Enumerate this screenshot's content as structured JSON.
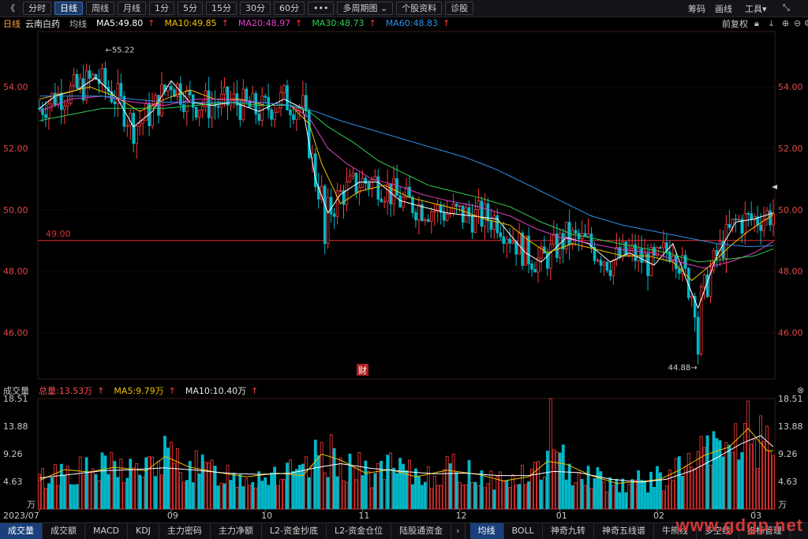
{
  "toolbar": {
    "back_icon": "《",
    "tabs": [
      "分时",
      "日线",
      "周线",
      "月线",
      "1分",
      "5分",
      "15分",
      "30分",
      "60分",
      "•••",
      "多周期图",
      "个股资料",
      "诊股"
    ],
    "active_tab": "日线",
    "right": [
      "筹码",
      "画线",
      "工具"
    ]
  },
  "stock": {
    "period": "日线",
    "name": "云南白药",
    "ma_label": "均线",
    "ma5": "MA5:49.80",
    "ma10": "MA10:49.85",
    "ma20": "MA20:48.97",
    "ma30": "MA30:48.73",
    "ma60": "MA60:48.83",
    "adjust": "前复权"
  },
  "volume": {
    "label": "成交量",
    "total": "总量:13.53万",
    "ma5": "MA5:9.79万",
    "ma10": "MA10:10.40万"
  },
  "bottom_tabs": [
    "成交量",
    "成交额",
    "MACD",
    "KDJ",
    "主力密码",
    "主力净额",
    "L2-资金抄底",
    "L2-资金仓位",
    "陆股通资金"
  ],
  "bottom_tabs_right": [
    "均线",
    "BOLL",
    "神奇九转",
    "神奇五线谱",
    "牛熊线",
    "多空线",
    "指标管理"
  ],
  "watermark": "www.gdgp.net",
  "colors": {
    "up": "#ff3a3a",
    "down": "#00b8c8",
    "ma5": "#ffffff",
    "ma10": "#f2c200",
    "ma20": "#e040c8",
    "ma30": "#2ecc55",
    "ma60": "#2f8fe8",
    "line49": "#e03030"
  },
  "chart_data": [
    {
      "type": "candlestick",
      "title": "云南白药 日线",
      "y_ticks": [
        "54.00",
        "52.00",
        "50.00",
        "48.00",
        "46.00"
      ],
      "x_ticks": [
        "2023/07",
        "09",
        "10",
        "11",
        "12",
        "01",
        "02",
        "03"
      ],
      "ylim": [
        44.5,
        55.8
      ],
      "annotations": {
        "high": "←55.22",
        "low": "44.88→",
        "hline": "49.00",
        "hline_value": 49.0,
        "marker": "财"
      },
      "ma": {
        "ma5": [
          [
            0,
            53.3
          ],
          [
            5,
            53.7
          ],
          [
            12,
            53.9
          ],
          [
            18,
            54.3
          ],
          [
            25,
            53.6
          ],
          [
            30,
            52.7
          ],
          [
            36,
            53.2
          ],
          [
            42,
            54.2
          ],
          [
            48,
            53.5
          ],
          [
            55,
            53.4
          ],
          [
            62,
            53.5
          ],
          [
            70,
            53.2
          ],
          [
            78,
            53.6
          ],
          [
            84,
            53.3
          ],
          [
            88,
            51.0
          ],
          [
            92,
            49.9
          ],
          [
            96,
            50.5
          ],
          [
            102,
            50.9
          ],
          [
            108,
            50.9
          ],
          [
            115,
            50.3
          ],
          [
            122,
            50.1
          ],
          [
            130,
            49.9
          ],
          [
            138,
            49.8
          ],
          [
            146,
            49.7
          ],
          [
            150,
            49.2
          ],
          [
            155,
            48.6
          ],
          [
            160,
            48.3
          ],
          [
            168,
            49.1
          ],
          [
            175,
            48.9
          ],
          [
            182,
            48.3
          ],
          [
            188,
            48.6
          ],
          [
            196,
            48.2
          ],
          [
            202,
            48.9
          ],
          [
            206,
            47.8
          ],
          [
            210,
            46.8
          ],
          [
            216,
            48.5
          ],
          [
            222,
            49.6
          ],
          [
            228,
            49.7
          ],
          [
            234,
            49.9
          ]
        ],
        "ma10": [
          [
            0,
            53.6
          ],
          [
            8,
            53.8
          ],
          [
            16,
            54.0
          ],
          [
            24,
            53.7
          ],
          [
            32,
            53.2
          ],
          [
            40,
            53.6
          ],
          [
            48,
            53.9
          ],
          [
            56,
            53.6
          ],
          [
            64,
            53.6
          ],
          [
            72,
            53.4
          ],
          [
            80,
            53.4
          ],
          [
            86,
            52.8
          ],
          [
            90,
            51.5
          ],
          [
            96,
            50.2
          ],
          [
            102,
            50.6
          ],
          [
            110,
            50.8
          ],
          [
            118,
            50.4
          ],
          [
            126,
            50.2
          ],
          [
            134,
            50.0
          ],
          [
            142,
            49.7
          ],
          [
            150,
            49.5
          ],
          [
            156,
            49.0
          ],
          [
            162,
            48.6
          ],
          [
            170,
            48.9
          ],
          [
            178,
            48.7
          ],
          [
            186,
            48.5
          ],
          [
            194,
            48.5
          ],
          [
            202,
            48.3
          ],
          [
            208,
            47.7
          ],
          [
            214,
            48.2
          ],
          [
            220,
            48.8
          ],
          [
            226,
            49.3
          ],
          [
            234,
            49.85
          ]
        ],
        "ma20": [
          [
            0,
            53.2
          ],
          [
            10,
            53.6
          ],
          [
            20,
            53.7
          ],
          [
            30,
            53.5
          ],
          [
            40,
            53.4
          ],
          [
            50,
            53.6
          ],
          [
            60,
            53.6
          ],
          [
            70,
            53.5
          ],
          [
            80,
            53.4
          ],
          [
            86,
            53.0
          ],
          [
            92,
            52.0
          ],
          [
            98,
            51.5
          ],
          [
            106,
            51.0
          ],
          [
            114,
            50.8
          ],
          [
            122,
            50.5
          ],
          [
            130,
            50.3
          ],
          [
            140,
            50.1
          ],
          [
            150,
            49.8
          ],
          [
            158,
            49.4
          ],
          [
            166,
            49.1
          ],
          [
            176,
            48.9
          ],
          [
            186,
            48.7
          ],
          [
            196,
            48.6
          ],
          [
            204,
            48.3
          ],
          [
            212,
            48.1
          ],
          [
            220,
            48.3
          ],
          [
            228,
            48.6
          ],
          [
            234,
            48.97
          ]
        ],
        "ma30": [
          [
            0,
            52.9
          ],
          [
            10,
            53.1
          ],
          [
            20,
            53.3
          ],
          [
            30,
            53.3
          ],
          [
            40,
            53.3
          ],
          [
            50,
            53.4
          ],
          [
            60,
            53.5
          ],
          [
            70,
            53.4
          ],
          [
            80,
            53.4
          ],
          [
            86,
            53.2
          ],
          [
            92,
            52.7
          ],
          [
            100,
            52.2
          ],
          [
            108,
            51.6
          ],
          [
            116,
            51.2
          ],
          [
            124,
            50.8
          ],
          [
            132,
            50.6
          ],
          [
            140,
            50.4
          ],
          [
            150,
            50.1
          ],
          [
            160,
            49.6
          ],
          [
            170,
            49.2
          ],
          [
            180,
            49.0
          ],
          [
            190,
            48.8
          ],
          [
            200,
            48.6
          ],
          [
            210,
            48.3
          ],
          [
            220,
            48.4
          ],
          [
            228,
            48.5
          ],
          [
            234,
            48.73
          ]
        ],
        "ma60": [
          [
            0,
            53.7
          ],
          [
            10,
            53.7
          ],
          [
            20,
            53.7
          ],
          [
            30,
            53.6
          ],
          [
            40,
            53.5
          ],
          [
            50,
            53.5
          ],
          [
            60,
            53.5
          ],
          [
            70,
            53.5
          ],
          [
            80,
            53.4
          ],
          [
            88,
            53.2
          ],
          [
            96,
            52.9
          ],
          [
            106,
            52.6
          ],
          [
            116,
            52.3
          ],
          [
            126,
            52.0
          ],
          [
            136,
            51.7
          ],
          [
            146,
            51.3
          ],
          [
            156,
            50.8
          ],
          [
            166,
            50.3
          ],
          [
            176,
            49.8
          ],
          [
            186,
            49.5
          ],
          [
            196,
            49.3
          ],
          [
            206,
            49.1
          ],
          [
            216,
            48.9
          ],
          [
            226,
            48.8
          ],
          [
            234,
            48.83
          ]
        ]
      }
    },
    {
      "type": "bar",
      "title": "成交量",
      "y_ticks": [
        "18.51",
        "13.88",
        "9.26",
        "4.63"
      ],
      "unit": "万",
      "ylim": [
        0,
        18.51
      ],
      "ma": {
        "ma5": [
          [
            0,
            4.8
          ],
          [
            8,
            6.6
          ],
          [
            16,
            6.2
          ],
          [
            24,
            7.0
          ],
          [
            34,
            6.4
          ],
          [
            40,
            8.8
          ],
          [
            48,
            7.0
          ],
          [
            56,
            6.2
          ],
          [
            66,
            5.4
          ],
          [
            76,
            6.0
          ],
          [
            84,
            5.6
          ],
          [
            90,
            9.2
          ],
          [
            96,
            8.2
          ],
          [
            104,
            6.0
          ],
          [
            112,
            6.6
          ],
          [
            120,
            5.4
          ],
          [
            130,
            6.5
          ],
          [
            140,
            5.8
          ],
          [
            148,
            4.7
          ],
          [
            156,
            5.4
          ],
          [
            162,
            8.0
          ],
          [
            168,
            7.5
          ],
          [
            176,
            5.6
          ],
          [
            184,
            4.3
          ],
          [
            192,
            4.6
          ],
          [
            198,
            5.0
          ],
          [
            204,
            6.5
          ],
          [
            212,
            9.0
          ],
          [
            220,
            10.4
          ],
          [
            226,
            13.5
          ],
          [
            232,
            9.79
          ]
        ],
        "ma10": [
          [
            0,
            5.2
          ],
          [
            10,
            5.8
          ],
          [
            20,
            6.4
          ],
          [
            30,
            6.6
          ],
          [
            40,
            6.9
          ],
          [
            50,
            6.5
          ],
          [
            60,
            6.0
          ],
          [
            70,
            5.8
          ],
          [
            80,
            6.0
          ],
          [
            88,
            6.9
          ],
          [
            96,
            7.6
          ],
          [
            106,
            6.8
          ],
          [
            116,
            6.3
          ],
          [
            126,
            5.9
          ],
          [
            136,
            6.0
          ],
          [
            146,
            5.6
          ],
          [
            156,
            5.6
          ],
          [
            164,
            6.3
          ],
          [
            172,
            6.1
          ],
          [
            182,
            5.0
          ],
          [
            192,
            4.5
          ],
          [
            200,
            5.0
          ],
          [
            208,
            6.4
          ],
          [
            216,
            8.6
          ],
          [
            224,
            11.0
          ],
          [
            230,
            12.3
          ],
          [
            234,
            10.4
          ]
        ]
      }
    }
  ]
}
